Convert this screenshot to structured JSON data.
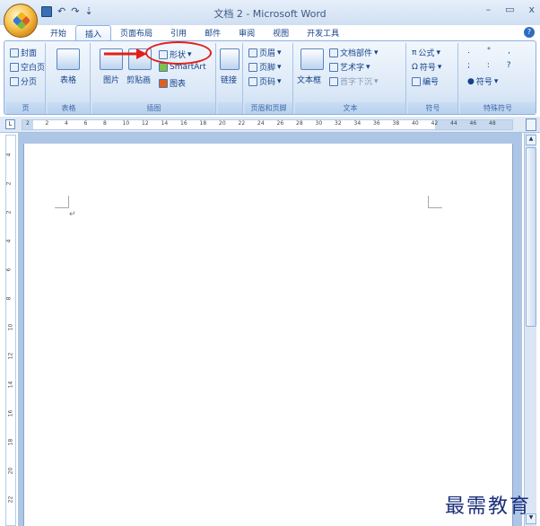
{
  "window": {
    "title": "文档 2 - Microsoft Word",
    "minimize": "–",
    "maximize": "▭",
    "close": "x"
  },
  "qat": {
    "undo": "↶",
    "redo": "↷",
    "customize": "⇣"
  },
  "tabs": [
    "开始",
    "插入",
    "页面布局",
    "引用",
    "邮件",
    "审阅",
    "视图",
    "开发工具"
  ],
  "active_tab": "插入",
  "ribbon": {
    "pages": {
      "label": "页",
      "items": [
        "封面",
        "空白页",
        "分页"
      ]
    },
    "table": {
      "label": "表格",
      "items": [
        "表格"
      ]
    },
    "illustrations": {
      "label": "插图",
      "items": [
        "图片",
        "剪贴画",
        "形状",
        "SmartArt",
        "图表"
      ]
    },
    "links": {
      "label": "",
      "items": [
        "链接"
      ]
    },
    "header_footer": {
      "label": "页眉和页脚",
      "items": [
        "页眉",
        "页脚",
        "页码"
      ]
    },
    "text": {
      "label": "文本",
      "items": [
        "文本框",
        "文档部件",
        "艺术字",
        "首字下沉"
      ]
    },
    "symbols": {
      "label": "符号",
      "items": [
        "公式",
        "符号",
        "编号"
      ]
    },
    "special": {
      "label": "特殊符号",
      "items": [
        "符号"
      ]
    }
  },
  "ruler": {
    "h_ticks": [
      "2",
      "2",
      "4",
      "6",
      "8",
      "10",
      "12",
      "14",
      "16",
      "18",
      "20",
      "22",
      "24",
      "26",
      "28",
      "30",
      "32",
      "34",
      "36",
      "38",
      "40",
      "42",
      "44",
      "46",
      "48"
    ],
    "v_ticks": [
      "4",
      "2",
      "2",
      "4",
      "6",
      "8",
      "10",
      "12",
      "14",
      "16",
      "18",
      "20",
      "22"
    ]
  },
  "document": {
    "paragraph_mark": "↵"
  },
  "watermark": "最需教育",
  "colors": {
    "annotation_red": "#e0201a",
    "ribbon_blue": "#dbe8f7"
  }
}
